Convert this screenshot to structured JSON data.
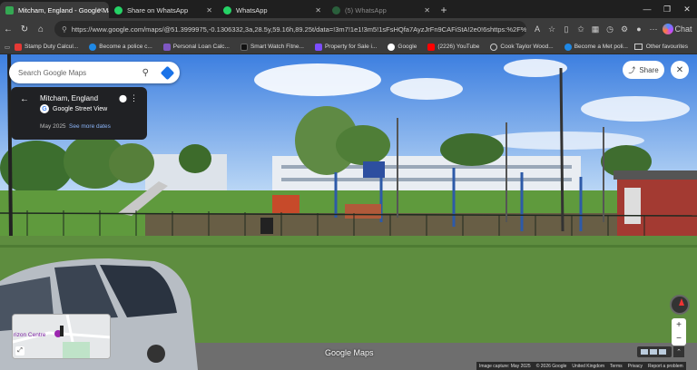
{
  "tabs": [
    {
      "label": "Mitcham, England - Google Maps",
      "active": true
    },
    {
      "label": "Share on WhatsApp",
      "active": false
    },
    {
      "label": "WhatsApp",
      "active": false
    },
    {
      "label": "(5) WhatsApp",
      "active": false
    }
  ],
  "address": {
    "url": "https://www.google.com/maps/@51.3999975,-0.1306332,3a,28.5y,59.16h,89.25t/data=!3m7!1e1!3m5!1sFsHQfa7AyzJrFn9CAFiStA!2e0!6shttps:%2F%2Fstre..."
  },
  "toolbar": {
    "chat_label": "Chat"
  },
  "bookmarks": [
    {
      "label": "Stamp Duty Calcul...",
      "color": "#e53935"
    },
    {
      "label": "Become a police c...",
      "color": "#1e88e5"
    },
    {
      "label": "Personal Loan Calc...",
      "color": "#7e57c2"
    },
    {
      "label": "Smart Watch Fitne...",
      "color": "#222222"
    },
    {
      "label": "Property for Sale i...",
      "color": "#7c4dff"
    },
    {
      "label": "Google",
      "color": "#ffffff"
    },
    {
      "label": "(2226) YouTube",
      "color": "#ff0000"
    },
    {
      "label": "Cook Taylor Wood...",
      "color": "#cccccc"
    },
    {
      "label": "Become a Met poli...",
      "color": "#1e88e5"
    }
  ],
  "bookmarks_other": "Other favourites",
  "maps": {
    "search_placeholder": "Search Google Maps",
    "place_title": "Mitcham, England",
    "street_view_label": "Google Street View",
    "capture_date": "May 2025",
    "see_more": "See more dates",
    "share_label": "Share",
    "minimap_label": "rizon Centre",
    "watermark": "Google Maps",
    "footer": [
      "Image capture: May 2025",
      "© 2026 Google",
      "United Kingdom",
      "Terms",
      "Privacy",
      "Report a problem"
    ]
  }
}
